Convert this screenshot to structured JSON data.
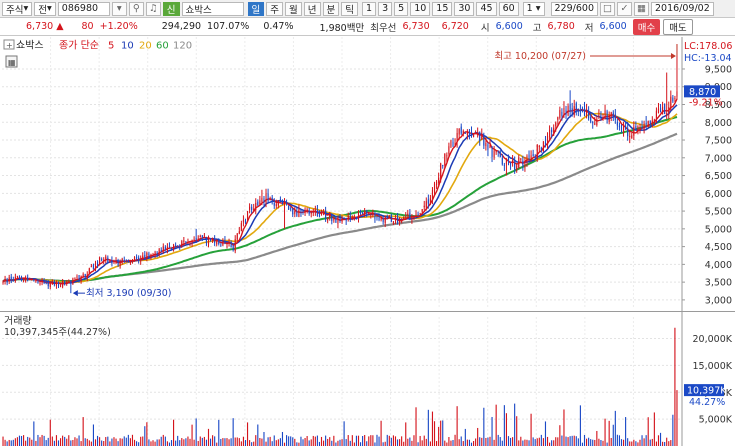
{
  "toolbar": {
    "market": "주식",
    "market_type": "전",
    "code": "086980",
    "stock_name": "쇼박스",
    "signal_label": "신",
    "periods": [
      "일",
      "주",
      "월",
      "년",
      "분",
      "틱"
    ],
    "intervals": [
      "1",
      "3",
      "5",
      "10",
      "15",
      "30",
      "45",
      "60"
    ],
    "unit": "1",
    "count": "229",
    "total": "/600",
    "date": "2016/09/02"
  },
  "quote": {
    "price": "6,730",
    "arrow": "▲",
    "change": "80",
    "change_pct": "+1.20%",
    "volume": "294,290",
    "volume_ratio": "107.07%",
    "turnover_pct": "0.47%",
    "amount": "1,980백만",
    "best_label": "최우선",
    "ask": "6,730",
    "bid": "6,720",
    "open_label": "시",
    "open": "6,600",
    "high_label": "고",
    "high": "6,780",
    "low_label": "저",
    "low": "6,600",
    "buy_label": "매수",
    "sell_label": "매도"
  },
  "colors": {
    "up": "#d4141c",
    "down": "#1b49c6",
    "ma5": "#d4141c",
    "ma10": "#1b3bb5",
    "ma20": "#e2a80e",
    "ma60": "#26a13a",
    "ma120": "#8a8a8a"
  },
  "chart_data": [
    {
      "type": "candlestick",
      "title": "쇼박스",
      "legend": {
        "prefix": "종가 단순",
        "periods": [
          "5",
          "10",
          "20",
          "60",
          "120"
        ]
      },
      "ylim": [
        2800,
        10400
      ],
      "y_ticks": [
        "3,000",
        "3,500",
        "4,000",
        "4,500",
        "5,000",
        "5,500",
        "6,000",
        "6,500",
        "7,000",
        "7,500",
        "8,000",
        "8,500",
        "9,000",
        "9,500"
      ],
      "lc": "LC:178.06",
      "hc": "HC:-13.04",
      "current_label": "8,870",
      "current_value": 8870,
      "current_pct": "-9.21%",
      "max_annotation": "최고 10,200 (07/27)",
      "max_value": 10200,
      "min_annotation": "최저 3,190 (09/30)",
      "min_value": 3190,
      "close_keypoints": [
        [
          0,
          3500
        ],
        [
          8,
          3650
        ],
        [
          16,
          3500
        ],
        [
          24,
          3450
        ],
        [
          32,
          3500
        ],
        [
          40,
          3700
        ],
        [
          48,
          4200
        ],
        [
          56,
          4050
        ],
        [
          64,
          4150
        ],
        [
          72,
          4300
        ],
        [
          80,
          4450
        ],
        [
          88,
          4600
        ],
        [
          96,
          4750
        ],
        [
          104,
          4600
        ],
        [
          112,
          4500
        ],
        [
          120,
          5600
        ],
        [
          128,
          5900
        ],
        [
          136,
          5650
        ],
        [
          144,
          5450
        ],
        [
          152,
          5500
        ],
        [
          160,
          5300
        ],
        [
          168,
          5250
        ],
        [
          176,
          5400
        ],
        [
          184,
          5300
        ],
        [
          192,
          5250
        ],
        [
          200,
          5350
        ],
        [
          208,
          5900
        ],
        [
          216,
          7200
        ],
        [
          224,
          7800
        ],
        [
          232,
          7600
        ],
        [
          240,
          7050
        ],
        [
          248,
          6800
        ],
        [
          256,
          6950
        ],
        [
          264,
          7500
        ],
        [
          272,
          8300
        ],
        [
          280,
          8450
        ],
        [
          288,
          8100
        ],
        [
          296,
          8200
        ],
        [
          304,
          7700
        ],
        [
          312,
          7900
        ],
        [
          318,
          8200
        ],
        [
          324,
          8450
        ],
        [
          328,
          8870
        ]
      ],
      "highlights": [
        [
          94,
          5000
        ],
        [
          126,
          6100
        ],
        [
          276,
          8900
        ],
        [
          323,
          9400
        ],
        [
          328,
          10200
        ]
      ],
      "lowlights": [
        [
          33,
          3190
        ],
        [
          137,
          5000
        ],
        [
          245,
          6500
        ]
      ]
    },
    {
      "type": "bar",
      "title": "거래량",
      "current_label": "10,397,345주(44.27%)",
      "y_ticks": [
        "5,000K",
        "10,000K",
        "15,000K",
        "20,000K"
      ],
      "ylim": [
        0,
        24000
      ],
      "current_tag": "10,397K",
      "pct_tag": "44.27%",
      "spike_value": 22000,
      "last_value": 10397
    }
  ]
}
